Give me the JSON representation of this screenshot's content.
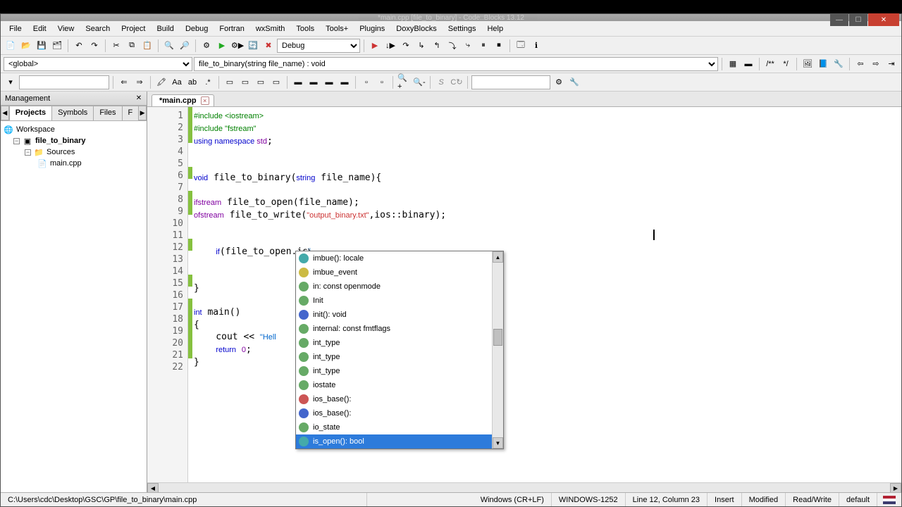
{
  "window": {
    "title": "*main.cpp [file_to_binary] - Code::Blocks 13.12"
  },
  "menu": [
    "File",
    "Edit",
    "View",
    "Search",
    "Project",
    "Build",
    "Debug",
    "Fortran",
    "wxSmith",
    "Tools",
    "Tools+",
    "Plugins",
    "DoxyBlocks",
    "Settings",
    "Help"
  ],
  "build_target": "Debug",
  "scope_dropdown": "<global>",
  "function_dropdown": "file_to_binary(string file_name) : void",
  "management": {
    "title": "Management",
    "tabs": [
      "Projects",
      "Symbols",
      "Files",
      "F"
    ],
    "active_tab": 0,
    "tree": {
      "root": "Workspace",
      "project": "file_to_binary",
      "folder": "Sources",
      "file": "main.cpp"
    }
  },
  "editor_tab": "*main.cpp",
  "code_lines": [
    {
      "n": 1,
      "pp": "#include ",
      "rest": "<iostream>"
    },
    {
      "n": 2,
      "pp": "#include ",
      "str": "\"fstream\""
    },
    {
      "n": 3,
      "text": "using namespace ",
      "kw": "std",
      ";": ";"
    },
    {
      "n": 4,
      "blank": true
    },
    {
      "n": 5,
      "blank": true
    },
    {
      "n": 6,
      "raw": "void file_to_binary(string file_name){"
    },
    {
      "n": 7,
      "blank": true
    },
    {
      "n": 8,
      "raw": "ifstream file_to_open(file_name);"
    },
    {
      "n": 9,
      "raw": "ofstream file_to_write(\"output_binary.txt\",ios::binary);"
    },
    {
      "n": 10,
      "blank": true
    },
    {
      "n": 11,
      "blank": true
    },
    {
      "n": 12,
      "raw": "    if(file_to_open.is)"
    },
    {
      "n": 13,
      "blank": true
    },
    {
      "n": 14,
      "blank": true
    },
    {
      "n": 15,
      "raw": "}"
    },
    {
      "n": 16,
      "blank": true
    },
    {
      "n": 17,
      "raw": "int main()"
    },
    {
      "n": 18,
      "raw": "{"
    },
    {
      "n": 19,
      "raw": "    cout << \"Hell"
    },
    {
      "n": 20,
      "raw": "    return 0;"
    },
    {
      "n": 21,
      "raw": "}"
    },
    {
      "n": 22,
      "blank": true
    }
  ],
  "autocomplete": {
    "items": [
      {
        "label": "imbue(): locale",
        "c": "#4aa"
      },
      {
        "label": "imbue_event",
        "c": "#cb4"
      },
      {
        "label": "in: const openmode",
        "c": "#6a6"
      },
      {
        "label": "Init",
        "c": "#6a6"
      },
      {
        "label": "init(): void",
        "c": "#46c"
      },
      {
        "label": "internal: const fmtflags",
        "c": "#6a6"
      },
      {
        "label": "int_type",
        "c": "#6a6"
      },
      {
        "label": "int_type",
        "c": "#6a6"
      },
      {
        "label": "int_type",
        "c": "#6a6"
      },
      {
        "label": "iostate",
        "c": "#6a6"
      },
      {
        "label": "ios_base():",
        "c": "#c55"
      },
      {
        "label": "ios_base():",
        "c": "#46c"
      },
      {
        "label": "io_state",
        "c": "#6a6"
      },
      {
        "label": "is_open(): bool",
        "c": "#4aa",
        "sel": true
      }
    ]
  },
  "status": {
    "path": "C:\\Users\\cdc\\Desktop\\GSC\\GP\\file_to_binary\\main.cpp",
    "eol": "Windows (CR+LF)",
    "encoding": "WINDOWS-1252",
    "pos": "Line 12, Column 23",
    "ins": "Insert",
    "mod": "Modified",
    "rw": "Read/Write",
    "profile": "default"
  }
}
